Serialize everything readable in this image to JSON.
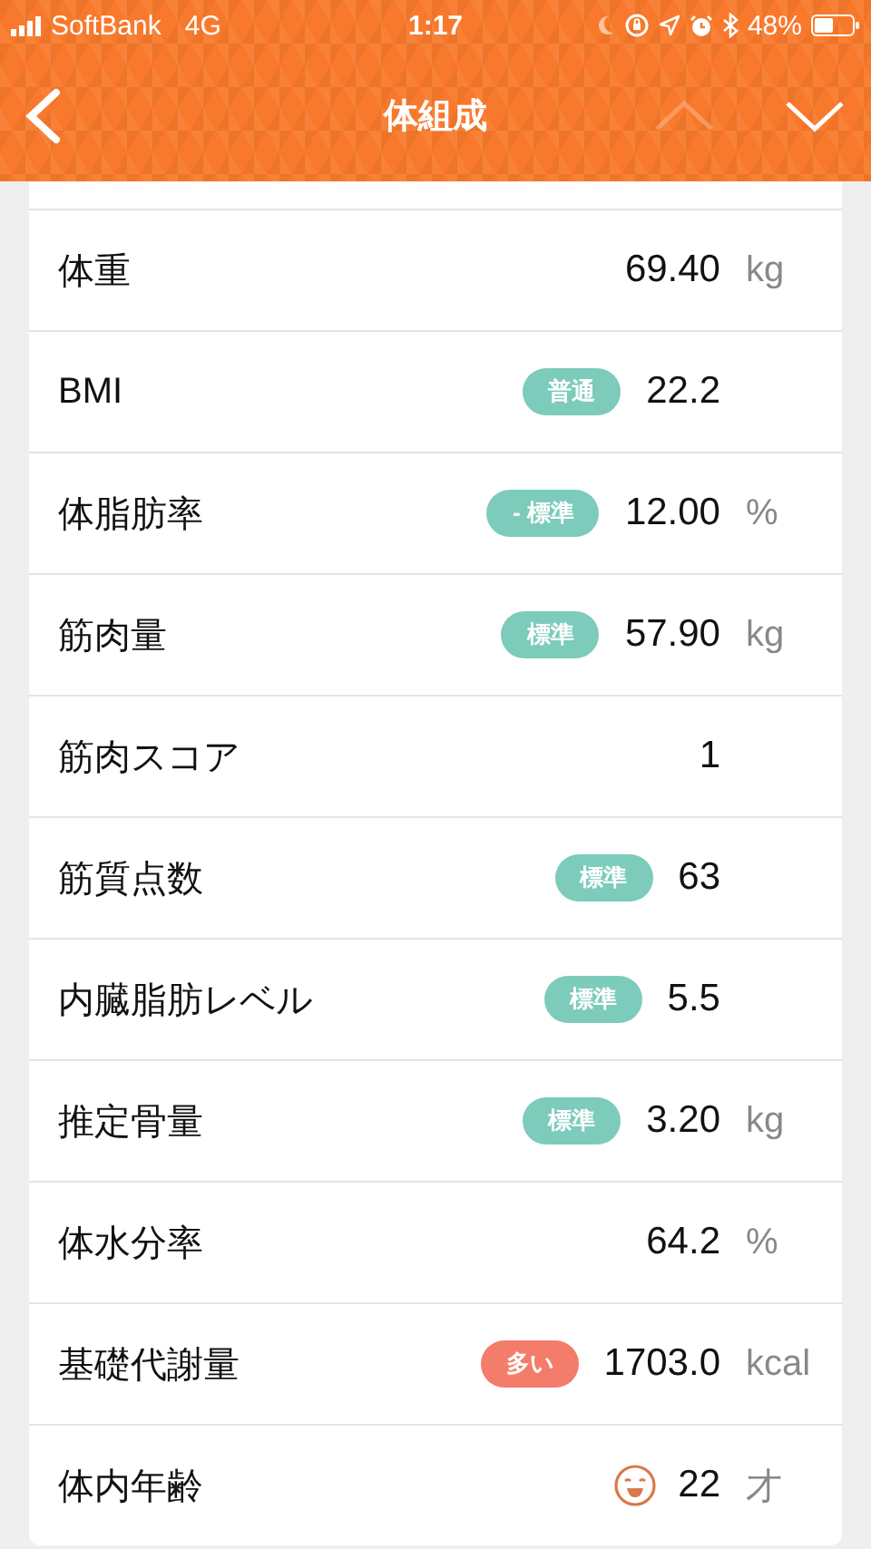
{
  "status_bar": {
    "carrier": "SoftBank",
    "network": "4G",
    "time": "1:17",
    "battery": "48%"
  },
  "nav": {
    "title": "体組成",
    "up_disabled": true,
    "down_disabled": false
  },
  "rows": [
    {
      "kind": "plain",
      "label": "体重",
      "value": "69.40",
      "unit": "kg"
    },
    {
      "kind": "badge",
      "label": "BMI",
      "badge": "普通",
      "color": "#7ccbbb",
      "value": "22.2"
    },
    {
      "kind": "badge",
      "label": "体脂肪率",
      "badge": "- 標準",
      "color": "#7ccbbb",
      "value": "12.00",
      "unit": "%"
    },
    {
      "kind": "badge",
      "label": "筋肉量",
      "badge": "標準",
      "color": "#7ccbbb",
      "value": "57.90",
      "unit": "kg"
    },
    {
      "kind": "plain",
      "label": "筋肉スコア",
      "value": "1"
    },
    {
      "kind": "badge",
      "label": "筋質点数",
      "badge": "標準",
      "color": "#7ccbbb",
      "value": "63"
    },
    {
      "kind": "badge",
      "label": "内臓脂肪レベル",
      "badge": "標準",
      "color": "#7ccbbb",
      "value": "5.5"
    },
    {
      "kind": "badge",
      "label": "推定骨量",
      "badge": "標準",
      "color": "#7ccbbb",
      "value": "3.20",
      "unit": "kg"
    },
    {
      "kind": "plain",
      "label": "体水分率",
      "value": "64.2",
      "unit": "%"
    },
    {
      "kind": "badge",
      "label": "基礎代謝量",
      "badge": "多い",
      "color": "#f47c6a",
      "value": "1703.0",
      "unit": "kcal"
    },
    {
      "kind": "face",
      "label": "体内年齢",
      "value": "22",
      "unit": "才"
    }
  ]
}
